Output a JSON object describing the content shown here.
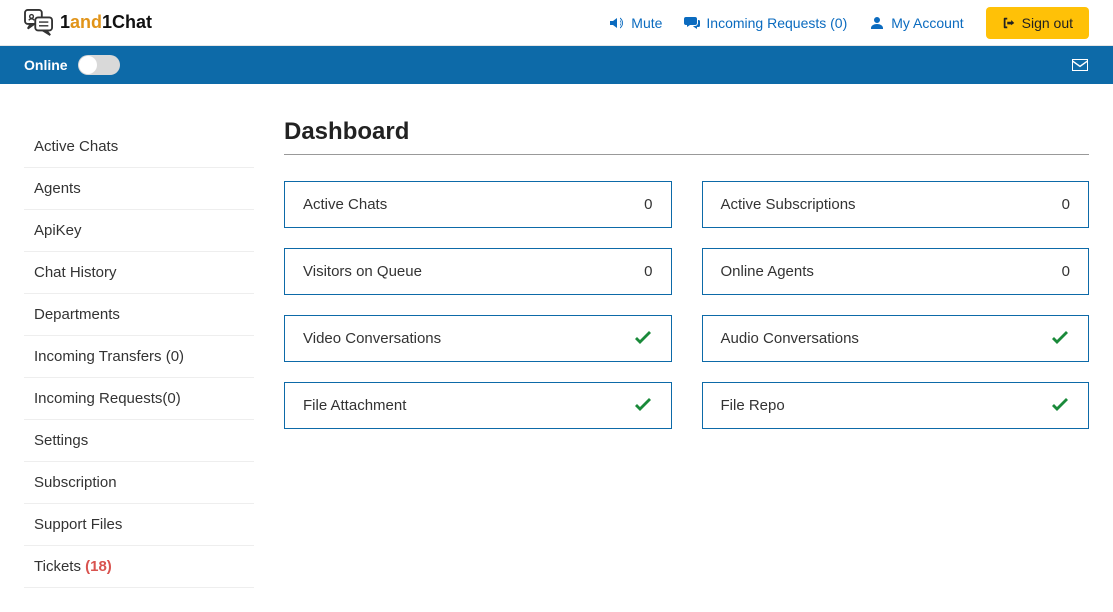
{
  "brand": {
    "part1": "1",
    "part2": "and",
    "part3": "1Chat"
  },
  "topnav": {
    "mute": "Mute",
    "incoming": "Incoming Requests (0)",
    "account": "My Account",
    "signout": "Sign out"
  },
  "statusbar": {
    "label": "Online"
  },
  "sidebar": {
    "items": [
      {
        "label": "Active Chats"
      },
      {
        "label": "Agents"
      },
      {
        "label": "ApiKey"
      },
      {
        "label": "Chat History"
      },
      {
        "label": "Departments"
      },
      {
        "label": "Incoming Transfers (0)"
      },
      {
        "label": "Incoming Requests(0)"
      },
      {
        "label": "Settings"
      },
      {
        "label": "Subscription"
      },
      {
        "label": "Support Files"
      }
    ],
    "tickets_label": "Tickets ",
    "tickets_badge": "(18)"
  },
  "page": {
    "title": "Dashboard"
  },
  "cards": [
    {
      "label": "Active Chats",
      "value": "0",
      "type": "count"
    },
    {
      "label": "Active Subscriptions",
      "value": "0",
      "type": "count"
    },
    {
      "label": "Visitors on Queue",
      "value": "0",
      "type": "count"
    },
    {
      "label": "Online Agents",
      "value": "0",
      "type": "count"
    },
    {
      "label": "Video Conversations",
      "type": "check"
    },
    {
      "label": "Audio Conversations",
      "type": "check"
    },
    {
      "label": "File Attachment",
      "type": "check"
    },
    {
      "label": "File Repo",
      "type": "check"
    }
  ]
}
